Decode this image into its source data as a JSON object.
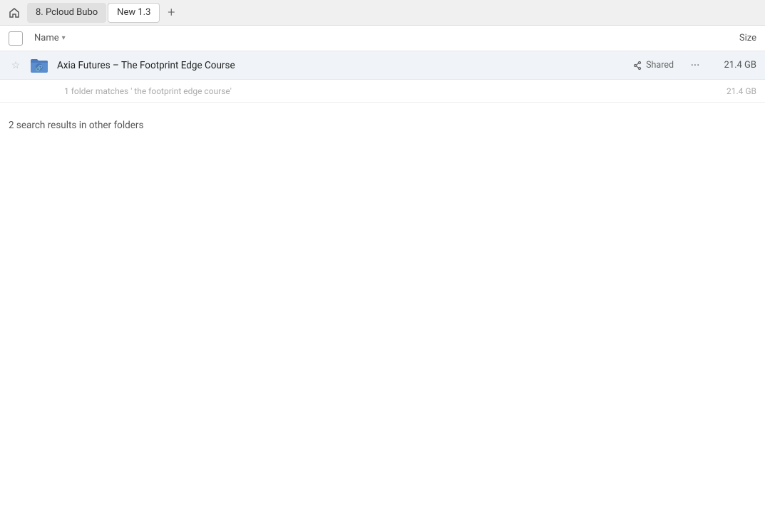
{
  "tabs": {
    "home_icon": "⌂",
    "items": [
      {
        "id": "tab1",
        "label": "8. Pcloud Bubo",
        "active": false
      },
      {
        "id": "tab2",
        "label": "New 1.3",
        "active": true
      }
    ],
    "add_button": "+"
  },
  "column_headers": {
    "name_label": "Name",
    "size_label": "Size"
  },
  "file_row": {
    "name": "Axia Futures – The Footprint Edge Course",
    "shared_label": "Shared",
    "size": "21.4 GB"
  },
  "summary": {
    "text": "1 folder matches ' the footprint edge course'",
    "size": "21.4 GB"
  },
  "other_folders": {
    "label": "2 search results in other folders"
  }
}
